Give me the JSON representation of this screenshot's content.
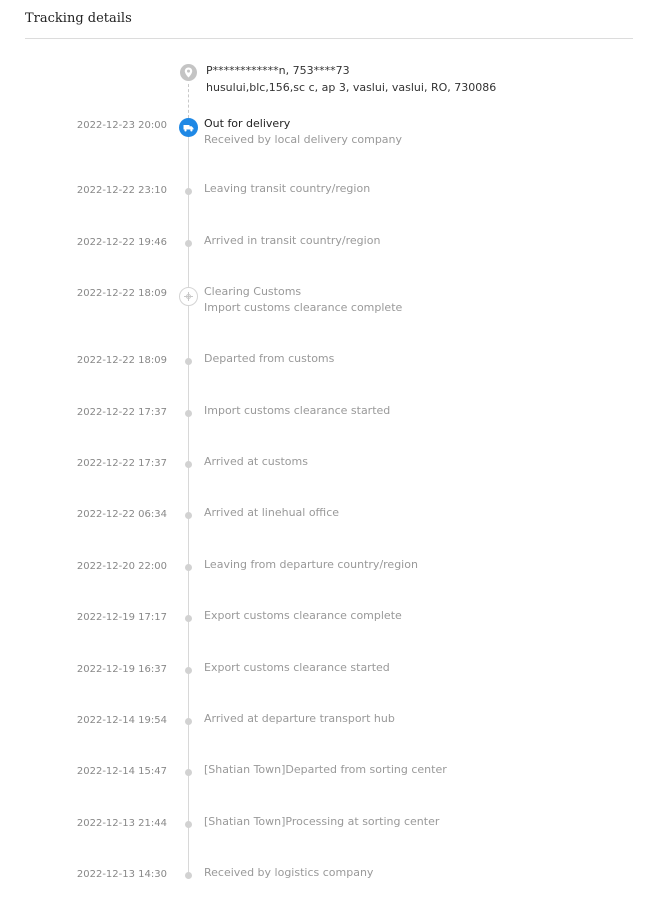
{
  "header": {
    "title": "Tracking details"
  },
  "address": {
    "recipient": "P************n,  753****73",
    "detail": "husului,blc,156,sc c, ap 3,  vaslui,  vaslui,  RO,  730086"
  },
  "events": [
    {
      "time": "2022-12-23 20:00",
      "status": "Out for delivery",
      "detail": "Received by local delivery company",
      "marker": "truck-icon",
      "active": true
    },
    {
      "time": "2022-12-22 23:10",
      "status": "Leaving transit country/region",
      "marker": "dot"
    },
    {
      "time": "2022-12-22 19:46",
      "status": "Arrived in transit country/region",
      "marker": "dot"
    },
    {
      "time": "2022-12-22 18:09",
      "status": "Clearing Customs",
      "detail": "Import customs clearance complete",
      "marker": "customs-icon"
    },
    {
      "time": "2022-12-22 18:09",
      "status": "Departed from customs",
      "marker": "dot"
    },
    {
      "time": "2022-12-22 17:37",
      "status": "Import customs clearance started",
      "marker": "dot"
    },
    {
      "time": "2022-12-22 17:37",
      "status": "Arrived at customs",
      "marker": "dot"
    },
    {
      "time": "2022-12-22 06:34",
      "status": "Arrived at linehual office",
      "marker": "dot"
    },
    {
      "time": "2022-12-20 22:00",
      "status": "Leaving from departure country/region",
      "marker": "dot"
    },
    {
      "time": "2022-12-19 17:17",
      "status": "Export customs clearance complete",
      "marker": "dot"
    },
    {
      "time": "2022-12-19 16:37",
      "status": "Export customs clearance started",
      "marker": "dot"
    },
    {
      "time": "2022-12-14 19:54",
      "status": "Arrived at departure transport hub",
      "marker": "dot"
    },
    {
      "time": "2022-12-14 15:47",
      "status": "[Shatian Town]Departed from sorting center",
      "marker": "dot"
    },
    {
      "time": "2022-12-13 21:44",
      "status": "[Shatian Town]Processing at sorting center",
      "marker": "dot"
    },
    {
      "time": "2022-12-13 14:30",
      "status": "Received by logistics company",
      "marker": "dot"
    }
  ],
  "colors": {
    "accent": "#1e88e5",
    "muted_text": "#999999",
    "timeline": "#d8d8d8"
  }
}
